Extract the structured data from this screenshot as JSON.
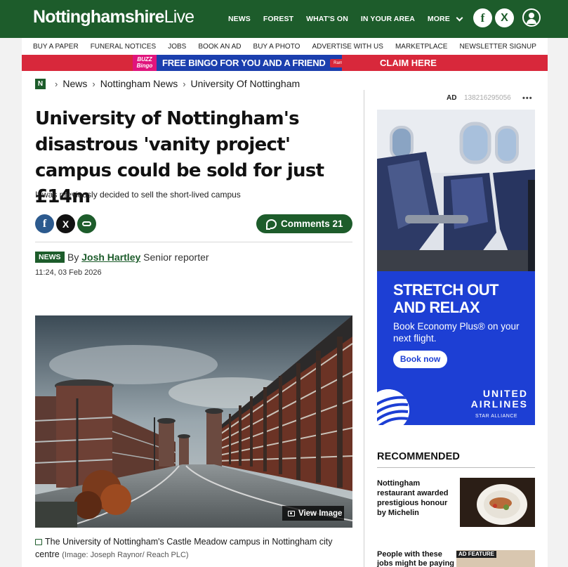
{
  "brand": {
    "part1": "Nottinghamshire",
    "part2": "Live"
  },
  "topnav": [
    "NEWS",
    "FOREST",
    "WHAT'S ON",
    "IN YOUR AREA"
  ],
  "topnav_more": "MORE",
  "social_top": {
    "facebook": "f",
    "x": "X"
  },
  "subnav": [
    "BUY A PAPER",
    "FUNERAL NOTICES",
    "JOBS",
    "BOOK AN AD",
    "BUY A PHOTO",
    "ADVERTISE WITH US",
    "MARKETPLACE",
    "NEWSLETTER SIGNUP"
  ],
  "banner": {
    "logo": "BUZZ Bingo",
    "text": "FREE BINGO FOR YOU AND A FRIEND",
    "partner": "Ramblerstyle",
    "cta": "CLAIM HERE"
  },
  "breadcrumb": {
    "home_icon": "N",
    "items": [
      "News",
      "Nottingham News",
      "University Of Nottingham"
    ]
  },
  "article": {
    "headline": "University of Nottingham's disastrous 'vanity project' campus could be sold for just £14m",
    "subheading": "It was previously decided to sell the short-lived campus",
    "share": {
      "facebook": "f",
      "x": "X"
    },
    "comments_label": "Comments 21",
    "badge": "NEWS",
    "by": "By",
    "author": "Josh Hartley",
    "role": "Senior reporter",
    "timestamp": "11:24, 03 Feb 2026",
    "view_image": "View Image",
    "caption": "The University of Nottingham's Castle Meadow campus in Nottingham city centre",
    "credit": "(Image: Joseph Raynor/ Reach PLC)"
  },
  "ad": {
    "label": "AD",
    "id": "138216295056",
    "menu": "•••",
    "headline": "STRETCH OUT AND RELAX",
    "body": "Book Economy Plus® on your next flight.",
    "button": "Book now",
    "brand": "UNITED AIRLINES",
    "alliance": "STAR ALLIANCE",
    "colors": {
      "blue": "#1d3fd4"
    }
  },
  "recommended": {
    "title": "RECOMMENDED",
    "items": [
      {
        "text": "Nottingham restaurant awarded prestigious honour by Michelin"
      },
      {
        "text": "People with these jobs might be paying",
        "badge": "AD FEATURE"
      }
    ]
  },
  "colors": {
    "brand_green": "#1d5c2b",
    "banner_red": "#d8283b",
    "banner_blue": "#1b3fae"
  }
}
